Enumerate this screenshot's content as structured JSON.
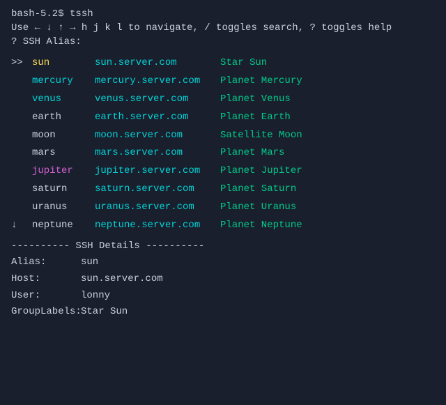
{
  "terminal": {
    "header": "bash-5.2$ tssh",
    "nav_hint": "Use ← ↓ ↑ → h j k l to navigate, / toggles search, ? toggles help",
    "prompt": "? SSH Alias:"
  },
  "table": {
    "rows": [
      {
        "indicator": ">>",
        "alias": "sun",
        "host": "sun.server.com",
        "desc": "Star Sun",
        "alias_class": "alias-selected",
        "selected": true
      },
      {
        "indicator": "",
        "alias": "mercury",
        "host": "mercury.server.com",
        "desc": "Planet Mercury",
        "alias_class": "alias-cyan",
        "selected": false
      },
      {
        "indicator": "",
        "alias": "venus",
        "host": "venus.server.com",
        "desc": "Planet Venus",
        "alias_class": "alias-cyan",
        "selected": false
      },
      {
        "indicator": "",
        "alias": "earth",
        "host": "earth.server.com",
        "desc": "Planet Earth",
        "alias_class": "alias-default",
        "selected": false
      },
      {
        "indicator": "",
        "alias": "moon",
        "host": "moon.server.com",
        "desc": "Satellite Moon",
        "alias_class": "alias-default",
        "selected": false
      },
      {
        "indicator": "",
        "alias": "mars",
        "host": "mars.server.com",
        "desc": "Planet Mars",
        "alias_class": "alias-default",
        "selected": false
      },
      {
        "indicator": "",
        "alias": "jupiter",
        "host": "jupiter.server.com",
        "desc": "Planet Jupiter",
        "alias_class": "alias-magenta",
        "selected": false
      },
      {
        "indicator": "",
        "alias": "saturn",
        "host": "saturn.server.com",
        "desc": "Planet Saturn",
        "alias_class": "alias-default",
        "selected": false
      },
      {
        "indicator": "",
        "alias": "uranus",
        "host": "uranus.server.com",
        "desc": "Planet Uranus",
        "alias_class": "alias-default",
        "selected": false
      },
      {
        "indicator": "↓",
        "alias": "neptune",
        "host": "neptune.server.com",
        "desc": "Planet Neptune",
        "alias_class": "alias-default",
        "selected": false
      }
    ]
  },
  "details": {
    "divider": "---------- SSH Details ----------",
    "fields": [
      {
        "label": "Alias:",
        "value": "sun"
      },
      {
        "label": "Host:",
        "value": "sun.server.com"
      },
      {
        "label": "User:",
        "value": "lonny"
      },
      {
        "label": "GroupLabels:",
        "value": "Star Sun"
      }
    ]
  }
}
